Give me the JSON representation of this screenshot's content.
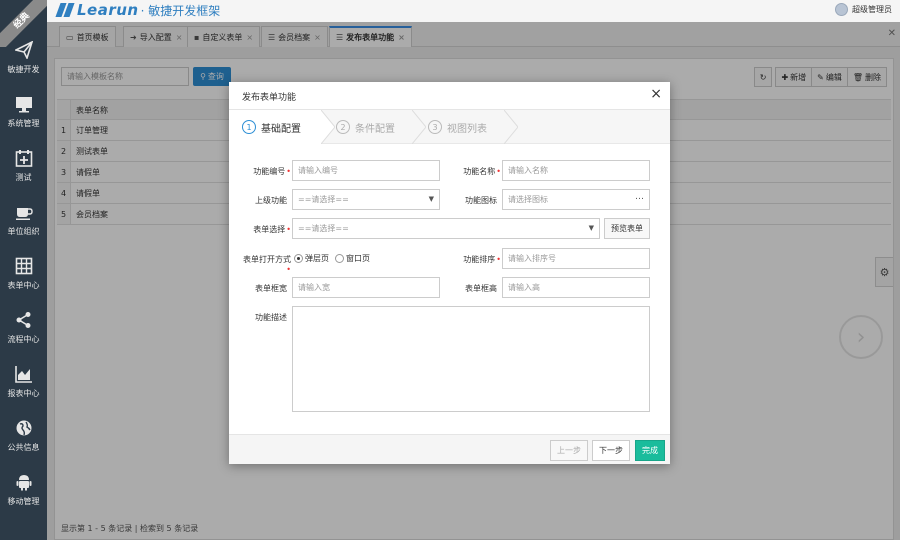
{
  "sidebar": {
    "ribbon": "经典",
    "items": [
      {
        "label": "敏捷开发",
        "icon": "paper-plane-icon"
      },
      {
        "label": "系统管理",
        "icon": "monitor-icon"
      },
      {
        "label": "测试",
        "icon": "calendar-plus-icon"
      },
      {
        "label": "单位组织",
        "icon": "coffee-icon"
      },
      {
        "label": "表单中心",
        "icon": "grid-icon"
      },
      {
        "label": "流程中心",
        "icon": "share-icon"
      },
      {
        "label": "报表中心",
        "icon": "area-chart-icon"
      },
      {
        "label": "公共信息",
        "icon": "globe-icon"
      },
      {
        "label": "移动管理",
        "icon": "android-icon"
      }
    ]
  },
  "header": {
    "logo_text": "Learun",
    "logo_sub": "· 敏捷开发框架",
    "user_name": "超级管理员"
  },
  "tabs": [
    {
      "label": "首页模板",
      "icon": "monitor-icon",
      "closable": false
    },
    {
      "label": "导入配置",
      "icon": "import-icon",
      "closable": true
    },
    {
      "label": "自定义表单",
      "icon": "cubes-icon",
      "closable": true
    },
    {
      "label": "会员档案",
      "icon": "list-icon",
      "closable": true
    },
    {
      "label": "发布表单功能",
      "icon": "list-icon",
      "closable": true
    }
  ],
  "page": {
    "search_placeholder": "请输入模板名称",
    "search_btn": "查询",
    "toolbar": {
      "refresh": "↻",
      "add": "新增",
      "edit": "编辑",
      "delete": "删除"
    },
    "grid_header": "表单名称",
    "rows": [
      {
        "n": "1",
        "name": "订单管理"
      },
      {
        "n": "2",
        "name": "测试表单"
      },
      {
        "n": "3",
        "name": "请假单"
      },
      {
        "n": "4",
        "name": "请假单"
      },
      {
        "n": "5",
        "name": "会员档案"
      }
    ],
    "footer": "显示第 1 - 5 条记录 | 检索到 5 条记录"
  },
  "dialog": {
    "title": "发布表单功能",
    "steps": [
      {
        "num": "1",
        "label": "基础配置"
      },
      {
        "num": "2",
        "label": "条件配置"
      },
      {
        "num": "3",
        "label": "视图列表"
      }
    ],
    "fields": {
      "code_label": "功能编号",
      "code_ph": "请输入编号",
      "name_label": "功能名称",
      "name_ph": "请输入名称",
      "parent_label": "上级功能",
      "parent_ph": "==请选择==",
      "icon_label": "功能图标",
      "icon_ph": "请选择图标",
      "form_label": "表单选择",
      "form_ph": "==请选择==",
      "preview_btn": "预览表单",
      "open_label": "表单打开方式",
      "open_opt1": "弹层页",
      "open_opt2": "窗口页",
      "sort_label": "功能排序",
      "sort_ph": "请输入排序号",
      "width_label": "表单框宽",
      "width_ph": "请输入宽",
      "height_label": "表单框高",
      "height_ph": "请输入高",
      "desc_label": "功能描述"
    },
    "buttons": {
      "prev": "上一步",
      "next": "下一步",
      "finish": "完成"
    }
  },
  "colors": {
    "sidebar": "#2c3a47",
    "primary": "#2d8fd5",
    "finish": "#1abc9c"
  }
}
